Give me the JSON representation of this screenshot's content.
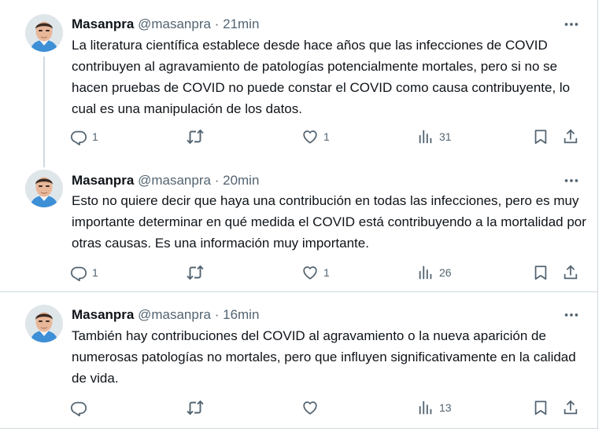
{
  "tweets": [
    {
      "author": "Masanpra",
      "handle": "@masanpra",
      "separator": "·",
      "time": "21min",
      "text": "La literatura científica establece desde hace años que las infecciones de COVID contribuyen al agravamiento de patologías potencialmente mortales, pero si no se hacen pruebas de COVID no puede constar el COVID como causa contribuyente, lo cual es una manipulación de los datos.",
      "replies": "1",
      "retweets": "",
      "likes": "1",
      "views": "31"
    },
    {
      "author": "Masanpra",
      "handle": "@masanpra",
      "separator": "·",
      "time": "20min",
      "text": "Esto no quiere decir que haya una contribución en todas las infecciones, pero es muy importante determinar en qué medida el COVID está contribuyendo a la mortalidad por otras causas. Es una información muy importante.",
      "replies": "1",
      "retweets": "",
      "likes": "1",
      "views": "26"
    },
    {
      "author": "Masanpra",
      "handle": "@masanpra",
      "separator": "·",
      "time": "16min",
      "text": "También hay contribuciones del COVID al agravamiento o la nueva aparición de numerosas patologías no mortales, pero que influyen significativamente en la calidad de vida.",
      "replies": "",
      "retweets": "",
      "likes": "",
      "views": "13"
    }
  ],
  "icons": {
    "reply": "reply-icon",
    "retweet": "retweet-icon",
    "like": "heart-icon",
    "views": "views-icon",
    "bookmark": "bookmark-icon",
    "share": "share-icon",
    "more": "more-icon"
  },
  "colors": {
    "text": "#0f1419",
    "secondary": "#536471",
    "border": "#cfd9de"
  }
}
